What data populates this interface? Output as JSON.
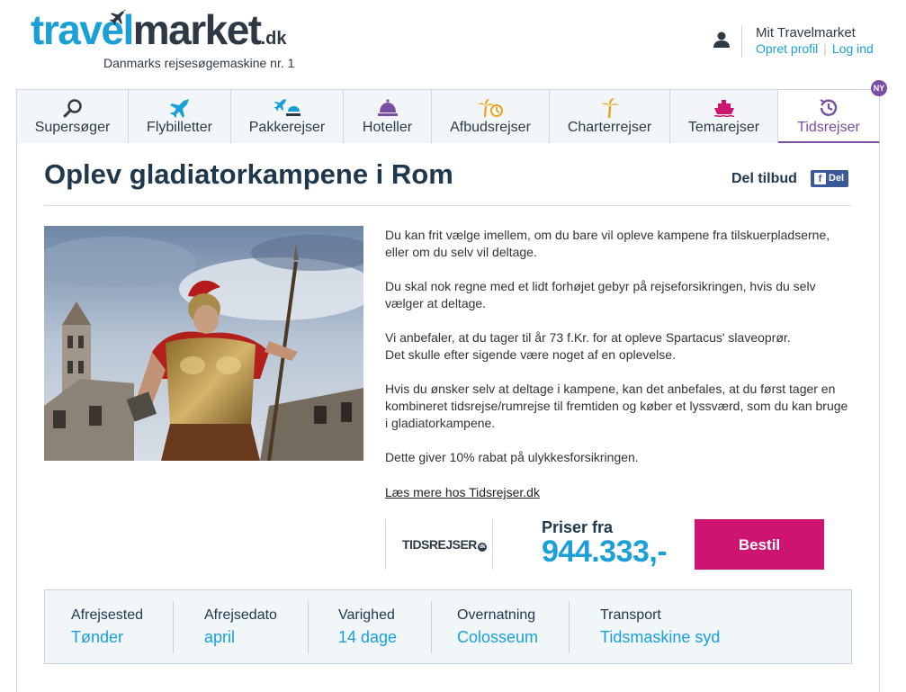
{
  "brand": {
    "logo_part1": "travel",
    "logo_part2": "market",
    "logo_tld": ".dk",
    "tagline": "Danmarks rejsesøgemaskine nr. 1",
    "accent_color": "#1a9fd9",
    "dark_color": "#2d3a46"
  },
  "account": {
    "title": "Mit Travelmarket",
    "create_profile": "Opret profil",
    "login": "Log ind",
    "icon": "user-icon"
  },
  "tabs": [
    {
      "label": "Supersøger",
      "icon": "search-icon",
      "active": false
    },
    {
      "label": "Flybilletter",
      "icon": "plane-icon",
      "active": false
    },
    {
      "label": "Pakkerejser",
      "icon": "plane-beach-icon",
      "active": false
    },
    {
      "label": "Hoteller",
      "icon": "hotel-bell-icon",
      "active": false
    },
    {
      "label": "Afbudsrejser",
      "icon": "palm-clock-icon",
      "active": false
    },
    {
      "label": "Charterrejser",
      "icon": "palm-icon",
      "active": false
    },
    {
      "label": "Temarejser",
      "icon": "cruise-ship-icon",
      "active": false
    },
    {
      "label": "Tidsrejser",
      "icon": "time-travel-icon",
      "active": true
    }
  ],
  "new_badge": "NY",
  "offer": {
    "title": "Oplev gladiatorkampene i Rom",
    "share_label": "Del tilbud",
    "fb_button": "Del",
    "paragraphs": [
      "Du kan frit vælge imellem, om du bare vil opleve kampene fra tilskuerpladserne, eller om du selv vil deltage.",
      "Du skal nok regne med et lidt forhøjet gebyr på rejseforsikringen, hvis du selv vælger at deltage.",
      "Vi anbefaler, at du tager til år 73 f.Kr. for at opleve Spartacus' slaveoprør.\nDet skulle efter sigende være noget af en oplevelse.",
      "Hvis du ønsker selv at deltage i kampene, kan det anbefales, at du først tager en kombineret tidsrejse/rumrejse til fremtiden og køber et lyssværd, som du kan bruge i gladiatorkampene.",
      "Dette giver 10% rabat på ulykkesforsikringen."
    ],
    "read_more": "Læs mere hos Tidsrejser.dk",
    "partner_logo": "TIDSREJSER",
    "partner_logo_suffix": "dk",
    "price_label": "Priser fra",
    "price_value": "944.333,-",
    "order_button": "Bestil",
    "order_color": "#cc1470"
  },
  "facts": [
    {
      "key": "Afrejsested",
      "value": "Tønder"
    },
    {
      "key": "Afrejsedato",
      "value": "april"
    },
    {
      "key": "Varighed",
      "value": "14 dage"
    },
    {
      "key": "Overnatning",
      "value": "Colosseum"
    },
    {
      "key": "Transport",
      "value": "Tidsmaskine syd"
    }
  ]
}
